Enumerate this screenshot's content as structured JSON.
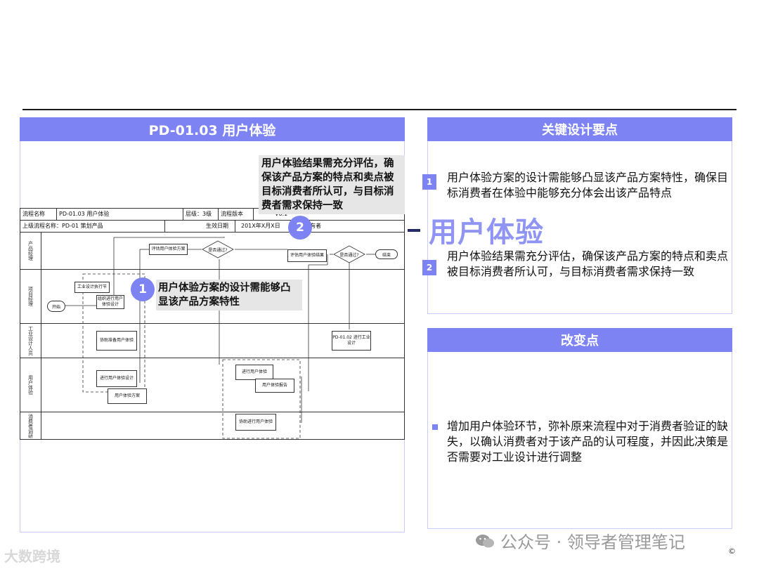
{
  "left_panel": {
    "title": "PD-01.03 用户体验",
    "table": {
      "row1": [
        "流程名称",
        "PD-01.03 用户体验",
        "层级：3级",
        "流程版本",
        "V0.1"
      ],
      "row2": [
        "上级流程名称：PD-01 策划产品",
        "生效日期",
        "201X年X月X日",
        "所有者"
      ],
      "lanes": [
        "产品经理",
        "项目经理",
        "工业设计人员",
        "用户体验",
        "消费者调研"
      ]
    },
    "nodes": {
      "start": "开始",
      "end": "结束",
      "n_task_prep": "工业设计执行节",
      "n_organize": "组织进行用户体验设计",
      "n_evaluate_plan": "评估用户体验方案",
      "n_pass1": "是否通过?",
      "n_evaluate_result": "评估用户体验结果",
      "n_pass2": "是否通过?",
      "n_assist_prep": "协助准备用户体验",
      "n_ind_design": "PD-01.02 进行工业设计",
      "n_ux_design": "进行用户体验设计",
      "n_ux_plan": "用户体验方案",
      "n_do_ux": "进行用户体验",
      "n_ux_report": "用户体验报告",
      "n_assist_ux": "协助进行用户体验"
    },
    "callout1": {
      "number": "1",
      "text": "用户体验方案的设计需能够凸显该产品方案特性"
    },
    "callout2": {
      "number": "2",
      "text": "用户体验结果需充分评估，确保该产品方案的特点和卖点被目标消费者所认可，与目标消费者需求保持一致"
    }
  },
  "overlay_title": "用户体验",
  "key_points": {
    "title": "关键设计要点",
    "items": [
      {
        "num": "1",
        "text": "用户体验方案的设计需能够凸显该产品方案特性，确保目标消费者在体验中能够充分体会出该产品特点"
      },
      {
        "num": "2",
        "text": "用户体验结果需充分评估，确保该产品方案的特点和卖点被目标消费者所认可，与目标消费者需求保持一致"
      }
    ]
  },
  "changes": {
    "title": "改变点",
    "items": [
      "增加用户体验环节，弥补原来流程中对于消费者验证的缺失，以确认消费者对于该产品的认可程度，并因此决策是否需要对工业设计进行调整"
    ]
  },
  "watermark": "公众号 · 领导者管理笔记",
  "brand": "大数跨境",
  "copyright": "©",
  "colors": {
    "accent": "#7d83f2",
    "dark": "#252a66"
  }
}
